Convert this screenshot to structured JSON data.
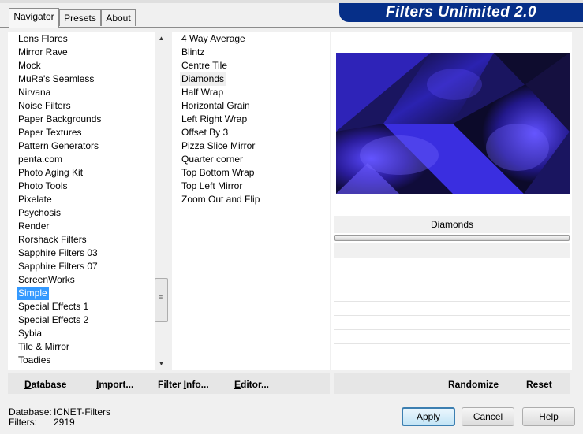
{
  "window": {
    "title": "Filters Unlimited 2.0"
  },
  "tabs": [
    {
      "label": "Navigator",
      "active": true
    },
    {
      "label": "Presets",
      "active": false
    },
    {
      "label": "About",
      "active": false
    }
  ],
  "categories": {
    "items": [
      "Lens Flares",
      "Mirror Rave",
      "Mock",
      "MuRa's Seamless",
      "Nirvana",
      "Noise Filters",
      "Paper Backgrounds",
      "Paper Textures",
      "Pattern Generators",
      "penta.com",
      "Photo Aging Kit",
      "Photo Tools",
      "Pixelate",
      "Psychosis",
      "Render",
      "Rorshack Filters",
      "Sapphire Filters 03",
      "Sapphire Filters 07",
      "ScreenWorks",
      "Simple",
      "Special Effects 1",
      "Special Effects 2",
      "Sybia",
      "Tile & Mirror",
      "Toadies"
    ],
    "selected": "Simple"
  },
  "effects": {
    "items": [
      "4 Way Average",
      "Blintz",
      "Centre Tile",
      "Diamonds",
      "Half Wrap",
      "Horizontal Grain",
      "Left Right Wrap",
      "Offset By 3",
      "Pizza Slice Mirror",
      "Quarter corner",
      "Top Bottom Wrap",
      "Top Left Mirror",
      "Zoom Out and Flip"
    ],
    "selected": "Diamonds"
  },
  "parameters": {
    "filter_name": "Diamonds"
  },
  "toolbar": {
    "database": {
      "accel": "D",
      "rest": "atabase"
    },
    "import": {
      "accel": "I",
      "rest": "mport..."
    },
    "filter_info": {
      "pre": "Filter ",
      "accel": "I",
      "rest": "nfo..."
    },
    "editor": {
      "accel": "E",
      "rest": "ditor..."
    },
    "randomize": "Randomize",
    "reset": "Reset"
  },
  "status": {
    "database_label": "Database:",
    "database_value": "ICNET-Filters",
    "filters_label": "Filters:",
    "filters_value": "2919"
  },
  "buttons": {
    "apply": "Apply",
    "cancel": "Cancel",
    "help": "Help"
  },
  "colors": {
    "banner": "#062f88",
    "selection": "#3399ff",
    "preview_dark": "#111122",
    "preview_purple": "#4a3aff"
  }
}
